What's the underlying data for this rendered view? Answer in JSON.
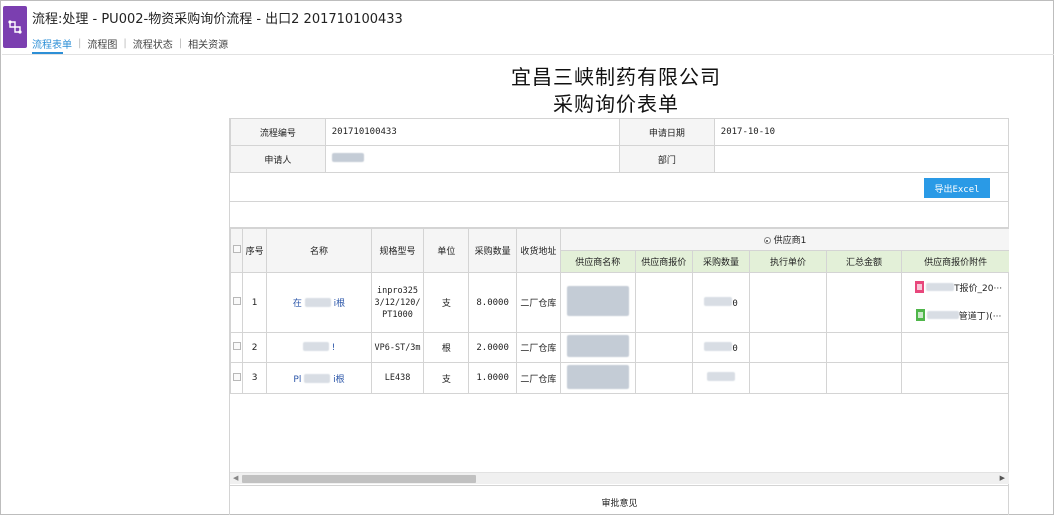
{
  "header": {
    "title": "流程:处理 - PU002-物资采购询价流程 - 出口2 201710100433",
    "tabs": [
      {
        "label": "流程表单",
        "active": true
      },
      {
        "label": "流程图",
        "active": false
      },
      {
        "label": "流程状态",
        "active": false
      },
      {
        "label": "相关资源",
        "active": false
      }
    ],
    "logo_icon": "workflow-logo-icon",
    "accent_color": "#2d8fd6",
    "logo_color": "#7b3fb0"
  },
  "form": {
    "company": "宜昌三峡制药有限公司",
    "title": "采购询价表单",
    "fields": {
      "flow_no_label": "流程编号",
      "flow_no": "201710100433",
      "apply_date_label": "申请日期",
      "apply_date": "2017-10-10",
      "applicant_label": "申请人",
      "department_label": "部门"
    },
    "export_label": "导出Excel",
    "review_label": "审批意见"
  },
  "grid": {
    "headers": {
      "seq": "序号",
      "name": "名称",
      "spec": "规格型号",
      "unit": "单位",
      "qty": "采购数量",
      "address": "收货地址",
      "supplier_group": "供应商1",
      "supplier_name": "供应商名称",
      "supplier_price": "供应商报价",
      "purchase_qty": "采购数量",
      "exec_price": "执行单价",
      "total": "汇总金额",
      "attachment": "供应商报价附件"
    },
    "rows": [
      {
        "seq": "1",
        "name_a": "在",
        "name_b": "i根",
        "spec": "inpro3253/12/120/PT1000",
        "unit": "支",
        "qty": "8.0000",
        "address": "二厂仓库",
        "purchase_qty_tail": "0"
      },
      {
        "seq": "2",
        "name_a": "",
        "name_b": "!",
        "spec": "VP6-ST/3m",
        "unit": "根",
        "qty": "2.0000",
        "address": "二厂仓库",
        "purchase_qty_tail": "0"
      },
      {
        "seq": "3",
        "name_a": "Pl",
        "name_b": "i根",
        "spec": "LE438",
        "unit": "支",
        "qty": "1.0000",
        "address": "二厂仓库",
        "purchase_qty_tail": ""
      }
    ],
    "attachments": [
      {
        "name": "T报价_20···",
        "icon": "pdf-file-icon"
      },
      {
        "name": "管道丁)(···",
        "icon": "excel-file-icon"
      }
    ],
    "supplier_header_color": "#e3f0d8"
  }
}
